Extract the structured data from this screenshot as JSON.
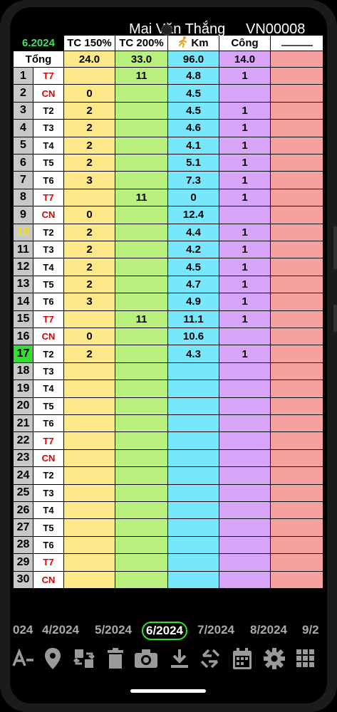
{
  "header": {
    "name": "Mai Văn Thắng",
    "code": "VN00008"
  },
  "columns": {
    "month": "6.2024",
    "tc150": "TC 150%",
    "tc200": "TC 200%",
    "km_icon": "runner-icon",
    "km": "Km",
    "cong": "Công"
  },
  "totals": {
    "label": "Tổng",
    "tc150": "24.0",
    "tc200": "33.0",
    "km": "96.0",
    "cong": "14.0"
  },
  "rows": [
    {
      "num": "1",
      "day": "T7",
      "tc150": "",
      "tc200": "11",
      "km": "4.8",
      "cong": "1"
    },
    {
      "num": "2",
      "day": "CN",
      "tc150": "0",
      "tc200": "",
      "km": "4.5",
      "cong": ""
    },
    {
      "num": "3",
      "day": "T2",
      "tc150": "2",
      "tc200": "",
      "km": "4.5",
      "cong": "1"
    },
    {
      "num": "4",
      "day": "T3",
      "tc150": "2",
      "tc200": "",
      "km": "4.6",
      "cong": "1"
    },
    {
      "num": "5",
      "day": "T4",
      "tc150": "2",
      "tc200": "",
      "km": "4.1",
      "cong": "1"
    },
    {
      "num": "6",
      "day": "T5",
      "tc150": "2",
      "tc200": "",
      "km": "5.1",
      "cong": "1"
    },
    {
      "num": "7",
      "day": "T6",
      "tc150": "3",
      "tc200": "",
      "km": "7.3",
      "cong": "1"
    },
    {
      "num": "8",
      "day": "T7",
      "tc150": "",
      "tc200": "11",
      "km": "0",
      "cong": "1"
    },
    {
      "num": "9",
      "day": "CN",
      "tc150": "0",
      "tc200": "",
      "km": "12.4",
      "cong": ""
    },
    {
      "num": "10",
      "day": "T2",
      "tc150": "2",
      "tc200": "",
      "km": "4.4",
      "cong": "1"
    },
    {
      "num": "11",
      "day": "T3",
      "tc150": "2",
      "tc200": "",
      "km": "4.2",
      "cong": "1"
    },
    {
      "num": "12",
      "day": "T4",
      "tc150": "2",
      "tc200": "",
      "km": "4.5",
      "cong": "1"
    },
    {
      "num": "13",
      "day": "T5",
      "tc150": "2",
      "tc200": "",
      "km": "4.7",
      "cong": "1"
    },
    {
      "num": "14",
      "day": "T6",
      "tc150": "3",
      "tc200": "",
      "km": "4.9",
      "cong": "1"
    },
    {
      "num": "15",
      "day": "T7",
      "tc150": "",
      "tc200": "11",
      "km": "11.1",
      "cong": "1"
    },
    {
      "num": "16",
      "day": "CN",
      "tc150": "0",
      "tc200": "",
      "km": "10.6",
      "cong": ""
    },
    {
      "num": "17",
      "day": "T2",
      "tc150": "2",
      "tc200": "",
      "km": "4.3",
      "cong": "1"
    },
    {
      "num": "18",
      "day": "T3",
      "tc150": "",
      "tc200": "",
      "km": "",
      "cong": ""
    },
    {
      "num": "19",
      "day": "T4",
      "tc150": "",
      "tc200": "",
      "km": "",
      "cong": ""
    },
    {
      "num": "20",
      "day": "T5",
      "tc150": "",
      "tc200": "",
      "km": "",
      "cong": ""
    },
    {
      "num": "21",
      "day": "T6",
      "tc150": "",
      "tc200": "",
      "km": "",
      "cong": ""
    },
    {
      "num": "22",
      "day": "T7",
      "tc150": "",
      "tc200": "",
      "km": "",
      "cong": ""
    },
    {
      "num": "23",
      "day": "CN",
      "tc150": "",
      "tc200": "",
      "km": "",
      "cong": ""
    },
    {
      "num": "24",
      "day": "T2",
      "tc150": "",
      "tc200": "",
      "km": "",
      "cong": ""
    },
    {
      "num": "25",
      "day": "T3",
      "tc150": "",
      "tc200": "",
      "km": "",
      "cong": ""
    },
    {
      "num": "26",
      "day": "T4",
      "tc150": "",
      "tc200": "",
      "km": "",
      "cong": ""
    },
    {
      "num": "27",
      "day": "T5",
      "tc150": "",
      "tc200": "",
      "km": "",
      "cong": ""
    },
    {
      "num": "28",
      "day": "T6",
      "tc150": "",
      "tc200": "",
      "km": "",
      "cong": ""
    },
    {
      "num": "29",
      "day": "T7",
      "tc150": "",
      "tc200": "",
      "km": "",
      "cong": ""
    },
    {
      "num": "30",
      "day": "CN",
      "tc150": "",
      "tc200": "",
      "km": "",
      "cong": ""
    }
  ],
  "months": [
    "024",
    "4/2024",
    "5/2024",
    "6/2024",
    "7/2024",
    "8/2024",
    "9/2"
  ],
  "active_month": "6/2024",
  "toolbar": [
    "font-size-icon",
    "location-pin-icon",
    "swap-icon",
    "trash-icon",
    "camera-icon",
    "download-icon",
    "sync-icon",
    "calendar-icon",
    "settings-icon",
    "grid-menu-icon"
  ],
  "colors": {
    "tc150": "#fde98a",
    "tc200": "#b9ef7c",
    "km": "#78e6fb",
    "cong": "#d8a4f7",
    "extra": "#f6a0a0",
    "accent": "#33dd33",
    "weekend": "#e00000"
  }
}
